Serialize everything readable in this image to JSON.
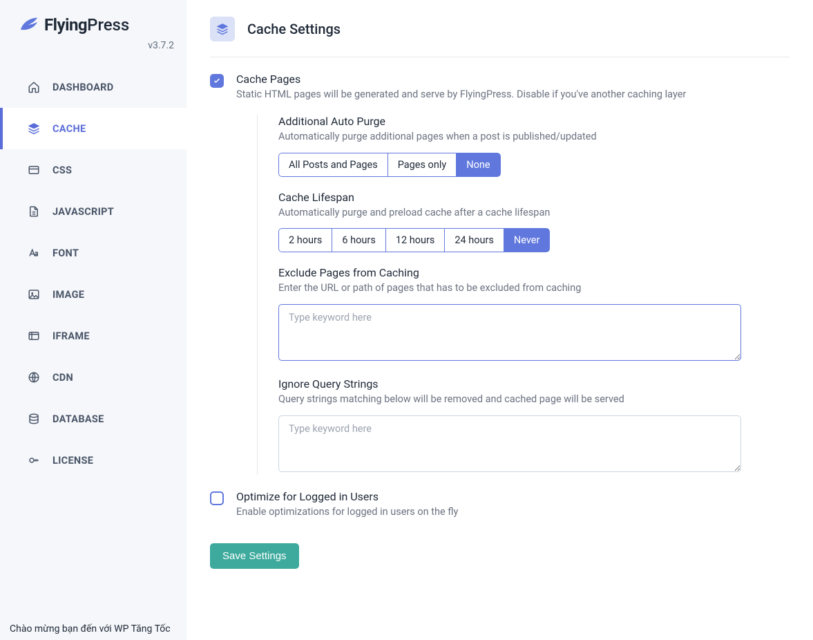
{
  "brand": {
    "bold": "Flying",
    "light": "Press"
  },
  "version": "v3.7.2",
  "nav": [
    {
      "label": "DASHBOARD",
      "icon": "home",
      "active": false
    },
    {
      "label": "CACHE",
      "icon": "layers",
      "active": true
    },
    {
      "label": "CSS",
      "icon": "card",
      "active": false
    },
    {
      "label": "JAVASCRIPT",
      "icon": "file",
      "active": false
    },
    {
      "label": "FONT",
      "icon": "font",
      "active": false
    },
    {
      "label": "IMAGE",
      "icon": "image",
      "active": false
    },
    {
      "label": "IFRAME",
      "icon": "frame",
      "active": false
    },
    {
      "label": "CDN",
      "icon": "globe",
      "active": false
    },
    {
      "label": "DATABASE",
      "icon": "database",
      "active": false
    },
    {
      "label": "LICENSE",
      "icon": "key",
      "active": false
    }
  ],
  "page": {
    "title": "Cache Settings"
  },
  "cache_pages": {
    "checked": true,
    "title": "Cache Pages",
    "desc": "Static HTML pages will be generated and serve by FlyingPress. Disable if you've another caching layer"
  },
  "auto_purge": {
    "title": "Additional Auto Purge",
    "desc": "Automatically purge additional pages when a post is published/updated",
    "options": [
      "All Posts and Pages",
      "Pages only",
      "None"
    ],
    "active_index": 2
  },
  "lifespan": {
    "title": "Cache Lifespan",
    "desc": "Automatically purge and preload cache after a cache lifespan",
    "options": [
      "2 hours",
      "6 hours",
      "12 hours",
      "24 hours",
      "Never"
    ],
    "active_index": 4
  },
  "exclude": {
    "title": "Exclude Pages from Caching",
    "desc": "Enter the URL or path of pages that has to be excluded from caching",
    "placeholder": "Type keyword here"
  },
  "ignore_qs": {
    "title": "Ignore Query Strings",
    "desc": "Query strings matching below will be removed and cached page will be served",
    "placeholder": "Type keyword here"
  },
  "logged_in": {
    "checked": false,
    "title": "Optimize for Logged in Users",
    "desc": "Enable optimizations for logged in users on the fly"
  },
  "save_label": "Save Settings",
  "footer": "Chào mừng bạn đến với WP Tăng Tốc"
}
